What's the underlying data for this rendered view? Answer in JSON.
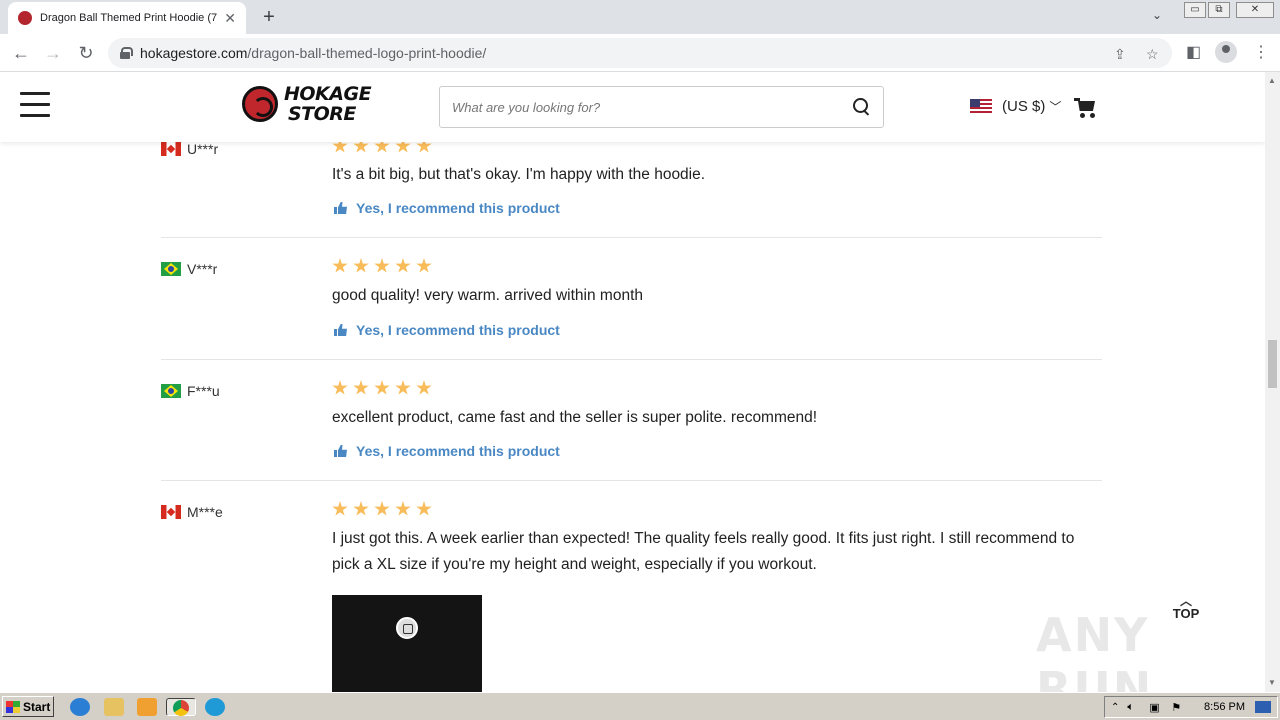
{
  "browser": {
    "tab_title": "Dragon Ball Themed Print Hoodie (7",
    "url_host": "hokagestore.com",
    "url_path": "/dragon-ball-themed-logo-print-hoodie/"
  },
  "header": {
    "logo_line1": "HOKAGE",
    "logo_line2": "STORE",
    "search_placeholder": "What are you looking for?",
    "currency_label": "(US $)"
  },
  "reviews": [
    {
      "country": "Canada",
      "reviewer": "U***r",
      "rating": 5,
      "text": "It's a bit big, but that's okay. I'm happy with the hoodie.",
      "recommend": "Yes, I recommend this product"
    },
    {
      "country": "Brazil",
      "reviewer": "V***r",
      "rating": 5,
      "text": "good quality! very warm. arrived within month",
      "recommend": "Yes, I recommend this product"
    },
    {
      "country": "Brazil",
      "reviewer": "F***u",
      "rating": 5,
      "text": "excellent product, came fast and the seller is super polite. recommend!",
      "recommend": "Yes, I recommend this product"
    },
    {
      "country": "Canada",
      "reviewer": "M***e",
      "rating": 5,
      "text": "I just got this. A week earlier than expected! The quality feels really good. It fits just right. I still recommend to pick a XL size if you're my height and weight, especially if you workout."
    }
  ],
  "top_label": "TOP",
  "watermark": "ANY RUN",
  "taskbar": {
    "start_label": "Start",
    "clock": "8:56 PM"
  },
  "colors": {
    "accent_link": "#4a88c4",
    "star": "#f5a623",
    "brand_red": "#c0272d"
  }
}
